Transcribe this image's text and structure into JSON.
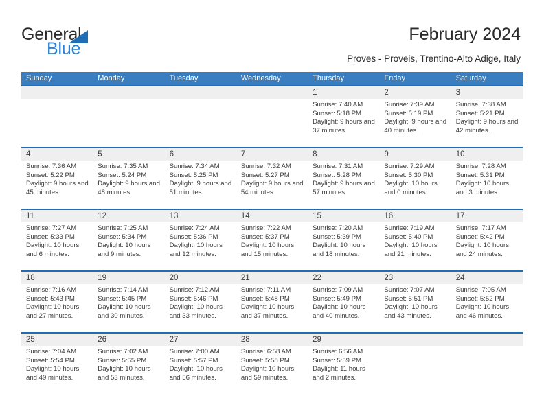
{
  "brand": {
    "name_top": "General",
    "name_bottom": "Blue",
    "accent_color": "#2b82d4",
    "triangle_color": "#1f6eb5"
  },
  "header": {
    "title": "February 2024",
    "subtitle": "Proves - Proveis, Trentino-Alto Adige, Italy"
  },
  "theme": {
    "header_row_bg": "#3a7ebf",
    "row_border": "#1f6eb5",
    "day_band_bg": "#efefef",
    "text": "#3b3b3b"
  },
  "labels": {
    "sunrise": "Sunrise:",
    "sunset": "Sunset:",
    "daylight": "Daylight:"
  },
  "weekdays": [
    "Sunday",
    "Monday",
    "Tuesday",
    "Wednesday",
    "Thursday",
    "Friday",
    "Saturday"
  ],
  "weeks": [
    [
      {
        "day": "",
        "empty": true
      },
      {
        "day": "",
        "empty": true
      },
      {
        "day": "",
        "empty": true
      },
      {
        "day": "",
        "empty": true
      },
      {
        "day": "1",
        "sunrise": "Sunrise: 7:40 AM",
        "sunset": "Sunset: 5:18 PM",
        "daylight": "Daylight: 9 hours and 37 minutes."
      },
      {
        "day": "2",
        "sunrise": "Sunrise: 7:39 AM",
        "sunset": "Sunset: 5:19 PM",
        "daylight": "Daylight: 9 hours and 40 minutes."
      },
      {
        "day": "3",
        "sunrise": "Sunrise: 7:38 AM",
        "sunset": "Sunset: 5:21 PM",
        "daylight": "Daylight: 9 hours and 42 minutes."
      }
    ],
    [
      {
        "day": "4",
        "sunrise": "Sunrise: 7:36 AM",
        "sunset": "Sunset: 5:22 PM",
        "daylight": "Daylight: 9 hours and 45 minutes."
      },
      {
        "day": "5",
        "sunrise": "Sunrise: 7:35 AM",
        "sunset": "Sunset: 5:24 PM",
        "daylight": "Daylight: 9 hours and 48 minutes."
      },
      {
        "day": "6",
        "sunrise": "Sunrise: 7:34 AM",
        "sunset": "Sunset: 5:25 PM",
        "daylight": "Daylight: 9 hours and 51 minutes."
      },
      {
        "day": "7",
        "sunrise": "Sunrise: 7:32 AM",
        "sunset": "Sunset: 5:27 PM",
        "daylight": "Daylight: 9 hours and 54 minutes."
      },
      {
        "day": "8",
        "sunrise": "Sunrise: 7:31 AM",
        "sunset": "Sunset: 5:28 PM",
        "daylight": "Daylight: 9 hours and 57 minutes."
      },
      {
        "day": "9",
        "sunrise": "Sunrise: 7:29 AM",
        "sunset": "Sunset: 5:30 PM",
        "daylight": "Daylight: 10 hours and 0 minutes."
      },
      {
        "day": "10",
        "sunrise": "Sunrise: 7:28 AM",
        "sunset": "Sunset: 5:31 PM",
        "daylight": "Daylight: 10 hours and 3 minutes."
      }
    ],
    [
      {
        "day": "11",
        "sunrise": "Sunrise: 7:27 AM",
        "sunset": "Sunset: 5:33 PM",
        "daylight": "Daylight: 10 hours and 6 minutes."
      },
      {
        "day": "12",
        "sunrise": "Sunrise: 7:25 AM",
        "sunset": "Sunset: 5:34 PM",
        "daylight": "Daylight: 10 hours and 9 minutes."
      },
      {
        "day": "13",
        "sunrise": "Sunrise: 7:24 AM",
        "sunset": "Sunset: 5:36 PM",
        "daylight": "Daylight: 10 hours and 12 minutes."
      },
      {
        "day": "14",
        "sunrise": "Sunrise: 7:22 AM",
        "sunset": "Sunset: 5:37 PM",
        "daylight": "Daylight: 10 hours and 15 minutes."
      },
      {
        "day": "15",
        "sunrise": "Sunrise: 7:20 AM",
        "sunset": "Sunset: 5:39 PM",
        "daylight": "Daylight: 10 hours and 18 minutes."
      },
      {
        "day": "16",
        "sunrise": "Sunrise: 7:19 AM",
        "sunset": "Sunset: 5:40 PM",
        "daylight": "Daylight: 10 hours and 21 minutes."
      },
      {
        "day": "17",
        "sunrise": "Sunrise: 7:17 AM",
        "sunset": "Sunset: 5:42 PM",
        "daylight": "Daylight: 10 hours and 24 minutes."
      }
    ],
    [
      {
        "day": "18",
        "sunrise": "Sunrise: 7:16 AM",
        "sunset": "Sunset: 5:43 PM",
        "daylight": "Daylight: 10 hours and 27 minutes."
      },
      {
        "day": "19",
        "sunrise": "Sunrise: 7:14 AM",
        "sunset": "Sunset: 5:45 PM",
        "daylight": "Daylight: 10 hours and 30 minutes."
      },
      {
        "day": "20",
        "sunrise": "Sunrise: 7:12 AM",
        "sunset": "Sunset: 5:46 PM",
        "daylight": "Daylight: 10 hours and 33 minutes."
      },
      {
        "day": "21",
        "sunrise": "Sunrise: 7:11 AM",
        "sunset": "Sunset: 5:48 PM",
        "daylight": "Daylight: 10 hours and 37 minutes."
      },
      {
        "day": "22",
        "sunrise": "Sunrise: 7:09 AM",
        "sunset": "Sunset: 5:49 PM",
        "daylight": "Daylight: 10 hours and 40 minutes."
      },
      {
        "day": "23",
        "sunrise": "Sunrise: 7:07 AM",
        "sunset": "Sunset: 5:51 PM",
        "daylight": "Daylight: 10 hours and 43 minutes."
      },
      {
        "day": "24",
        "sunrise": "Sunrise: 7:05 AM",
        "sunset": "Sunset: 5:52 PM",
        "daylight": "Daylight: 10 hours and 46 minutes."
      }
    ],
    [
      {
        "day": "25",
        "sunrise": "Sunrise: 7:04 AM",
        "sunset": "Sunset: 5:54 PM",
        "daylight": "Daylight: 10 hours and 49 minutes."
      },
      {
        "day": "26",
        "sunrise": "Sunrise: 7:02 AM",
        "sunset": "Sunset: 5:55 PM",
        "daylight": "Daylight: 10 hours and 53 minutes."
      },
      {
        "day": "27",
        "sunrise": "Sunrise: 7:00 AM",
        "sunset": "Sunset: 5:57 PM",
        "daylight": "Daylight: 10 hours and 56 minutes."
      },
      {
        "day": "28",
        "sunrise": "Sunrise: 6:58 AM",
        "sunset": "Sunset: 5:58 PM",
        "daylight": "Daylight: 10 hours and 59 minutes."
      },
      {
        "day": "29",
        "sunrise": "Sunrise: 6:56 AM",
        "sunset": "Sunset: 5:59 PM",
        "daylight": "Daylight: 11 hours and 2 minutes."
      },
      {
        "day": "",
        "empty": true
      },
      {
        "day": "",
        "empty": true
      }
    ]
  ]
}
